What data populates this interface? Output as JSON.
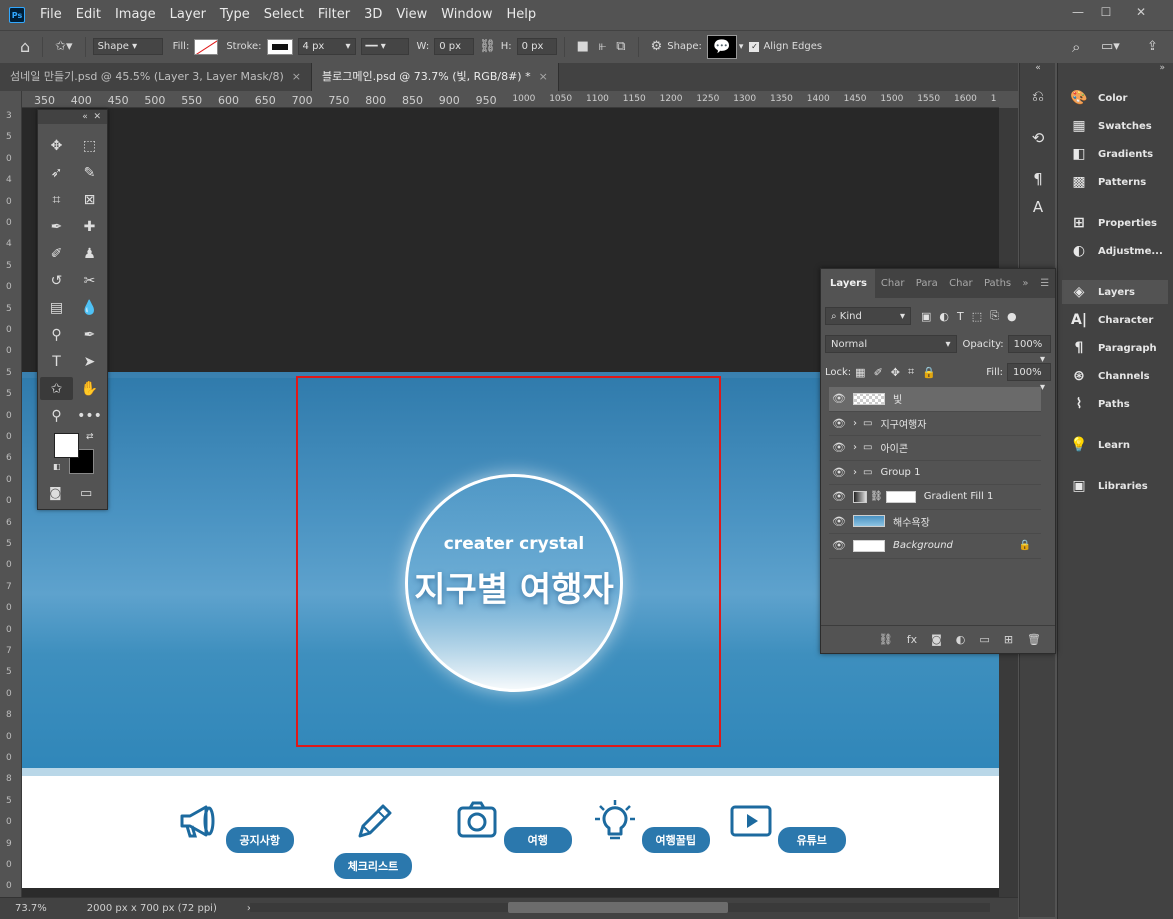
{
  "app": {
    "logo": "Ps",
    "menu": [
      "File",
      "Edit",
      "Image",
      "Layer",
      "Type",
      "Select",
      "Filter",
      "3D",
      "View",
      "Window",
      "Help"
    ]
  },
  "options_bar": {
    "tool_mode": "Shape",
    "fill_label": "Fill:",
    "stroke_label": "Stroke:",
    "stroke_width": "4 px",
    "w_label": "W:",
    "w_value": "0 px",
    "h_label": "H:",
    "h_value": "0 px",
    "shape_label": "Shape:",
    "align_edges_label": "Align Edges"
  },
  "tabs": [
    {
      "title": "섬네일 만들기.psd @ 45.5% (Layer 3, Layer Mask/8)"
    },
    {
      "title": "블로그메인.psd @ 73.7% (빛, RGB/8#) *"
    }
  ],
  "ruler_h": [
    "350",
    "400",
    "450",
    "500",
    "550",
    "600",
    "650",
    "700",
    "750",
    "800",
    "850",
    "900",
    "950",
    "1000",
    "1050",
    "1100",
    "1150",
    "1200",
    "1250",
    "1300",
    "1350",
    "1400",
    "1450",
    "1500",
    "1550",
    "1600",
    "1"
  ],
  "ruler_v": [
    "3",
    "5",
    "0",
    "4",
    "0",
    "0",
    "4",
    "5",
    "0",
    "5",
    "0",
    "0",
    "5",
    "5",
    "0",
    "0",
    "6",
    "0",
    "0",
    "6",
    "5",
    "0",
    "7",
    "0",
    "0",
    "7",
    "5",
    "0",
    "8",
    "0",
    "0",
    "8",
    "5",
    "0",
    "9",
    "0",
    "0"
  ],
  "canvas": {
    "subtitle": "creater crystal",
    "title": "지구별 여행자",
    "nav": [
      {
        "label": "공지사항"
      },
      {
        "label": "체크리스트"
      },
      {
        "label": "여행"
      },
      {
        "label": "여행꿀팁"
      },
      {
        "label": "유튜브"
      }
    ]
  },
  "right_dock": [
    {
      "label": "Color"
    },
    {
      "label": "Swatches"
    },
    {
      "label": "Gradients"
    },
    {
      "label": "Patterns"
    },
    {
      "label": "Properties"
    },
    {
      "label": "Adjustme..."
    },
    {
      "label": "Layers"
    },
    {
      "label": "Character"
    },
    {
      "label": "Paragraph"
    },
    {
      "label": "Channels"
    },
    {
      "label": "Paths"
    },
    {
      "label": "Learn"
    },
    {
      "label": "Libraries"
    }
  ],
  "layers_panel": {
    "tabs": [
      "Layers",
      "Char",
      "Para",
      "Char",
      "Paths"
    ],
    "filter_kind": "Kind",
    "blend_mode": "Normal",
    "opacity_label": "Opacity:",
    "opacity_value": "100%",
    "lock_label": "Lock:",
    "fill_label": "Fill:",
    "fill_value": "100%",
    "layers": [
      {
        "name": "빛"
      },
      {
        "name": "지구여행자"
      },
      {
        "name": "아이콘"
      },
      {
        "name": "Group 1"
      },
      {
        "name": "Gradient Fill 1"
      },
      {
        "name": "해수욕장"
      },
      {
        "name": "Background"
      }
    ]
  },
  "status": {
    "zoom": "73.7%",
    "doc_size": "2000 px x 700 px (72 ppi)"
  },
  "colors": {
    "selection_rect": "#e01818",
    "brand_blue": "#2b78ad",
    "fg_swatch": "#ffffff",
    "bg_swatch": "#000000"
  }
}
